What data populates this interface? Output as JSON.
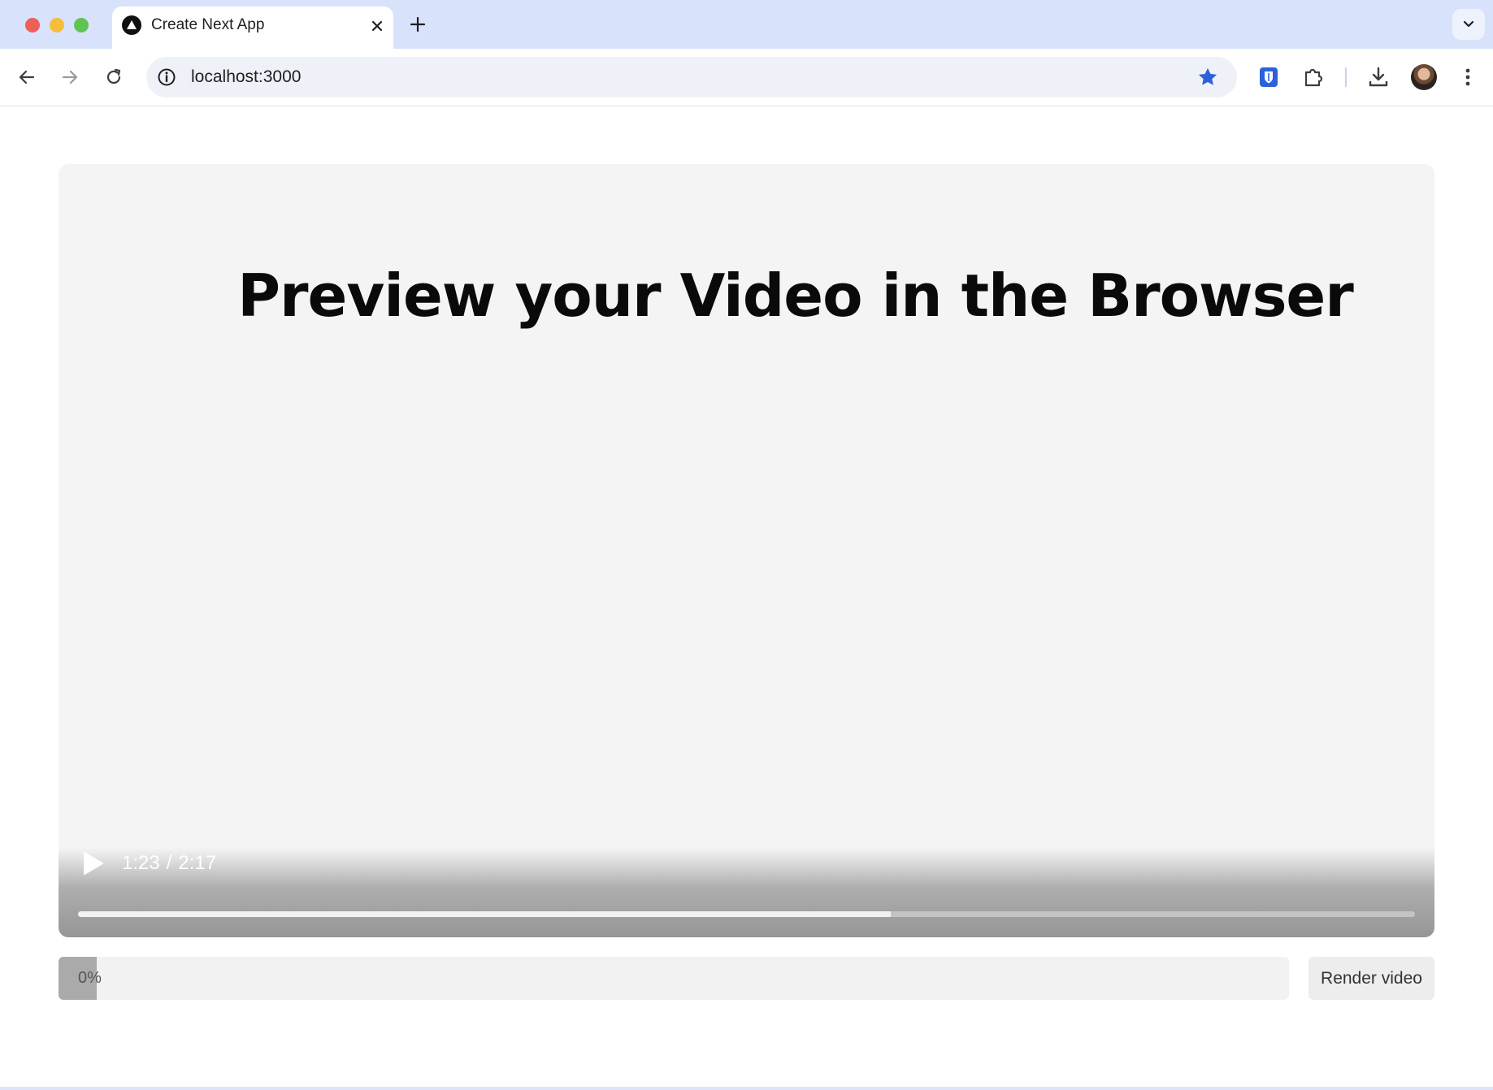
{
  "browser": {
    "tab": {
      "title": "Create Next App"
    },
    "address_bar": {
      "url": "localhost:3000"
    }
  },
  "page": {
    "video": {
      "headline": "Preview your Video in the Browser",
      "current_time": "1:23",
      "separator": "/",
      "duration": "2:17",
      "progress_fraction": 0.608
    },
    "render": {
      "progress_label": "0%",
      "progress_fraction": 0.0,
      "button_label": "Render video"
    }
  },
  "colors": {
    "bookmark_star": "#2a62d8",
    "password_manager": "#2a62d8"
  },
  "icons": [
    "back-arrow-icon",
    "forward-arrow-icon",
    "reload-icon",
    "site-info-icon",
    "star-icon",
    "password-manager-icon",
    "puzzle-icon",
    "download-icon",
    "kebab-menu-icon",
    "play-icon",
    "close-icon",
    "plus-icon",
    "chevron-down-icon"
  ]
}
